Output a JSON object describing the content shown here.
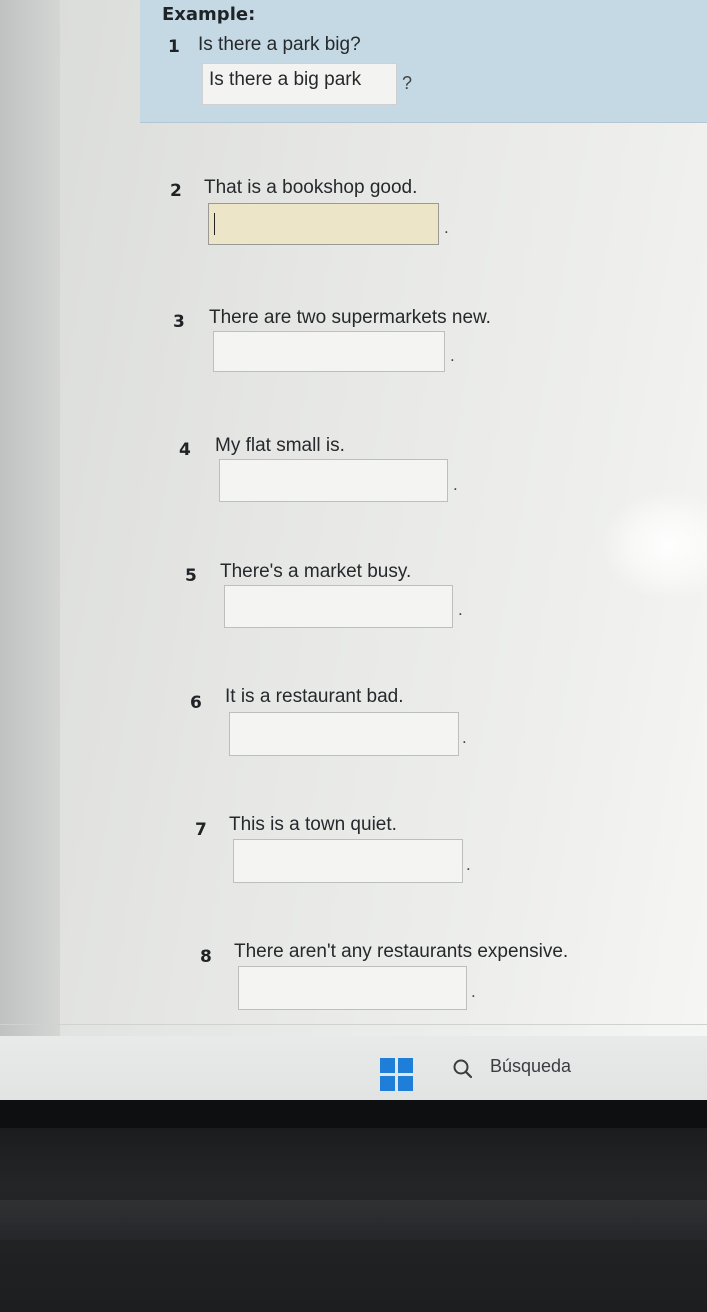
{
  "example": {
    "heading": "Example:",
    "number": "1",
    "sentence": "Is there a park big?",
    "answer": "Is there a big park",
    "end_mark": "?"
  },
  "questions": [
    {
      "number": "2",
      "sentence": "That is a bookshop good.",
      "answer_value": "",
      "end_mark": "."
    },
    {
      "number": "3",
      "sentence": "There are two supermarkets new.",
      "answer_value": "",
      "end_mark": "."
    },
    {
      "number": "4",
      "sentence": "My flat small is.",
      "answer_value": "",
      "end_mark": "."
    },
    {
      "number": "5",
      "sentence": "There's a market busy.",
      "answer_value": "",
      "end_mark": "."
    },
    {
      "number": "6",
      "sentence": "It is a restaurant bad.",
      "answer_value": "",
      "end_mark": "."
    },
    {
      "number": "7",
      "sentence": "This is a town quiet.",
      "answer_value": "",
      "end_mark": "."
    },
    {
      "number": "8",
      "sentence": "There aren't any restaurants expensive.",
      "answer_value": "",
      "end_mark": "."
    }
  ],
  "taskbar": {
    "start_icon": "windows-start-icon",
    "search_icon": "magnifier-icon",
    "search_label": "Búsqueda"
  },
  "colors": {
    "example_background": "#c5d9e5",
    "active_field": "#ede5c8",
    "start_blue": "#1f7fd8"
  }
}
